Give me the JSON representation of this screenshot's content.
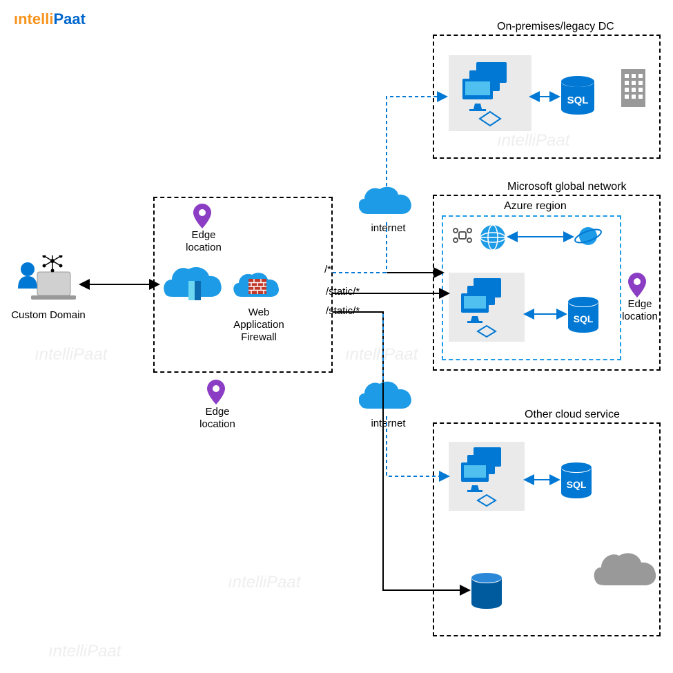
{
  "logo": {
    "prefix": "ıntelli",
    "suffix": "Paat"
  },
  "boxes": {
    "onprem": "On-premises/legacy DC",
    "msglobal": "Microsoft global network",
    "azureregion": "Azure region",
    "othercloud": "Other cloud service"
  },
  "labels": {
    "customdomain": "Custom Domain",
    "edge1": "Edge location",
    "edge2": "Edge location",
    "edge3": "Edge location",
    "waf": "Web Application Firewall",
    "internet1": "internet",
    "internet2": "internet",
    "route1": "/*",
    "route2": "/static/*",
    "route3": "/static/*",
    "sql": "SQL"
  },
  "colors": {
    "azure": "#0078d4",
    "azuredark": "#005a9e",
    "purple": "#8b3dc4",
    "orange": "#f7941d",
    "gray": "#999",
    "brick": "#c0392b"
  }
}
